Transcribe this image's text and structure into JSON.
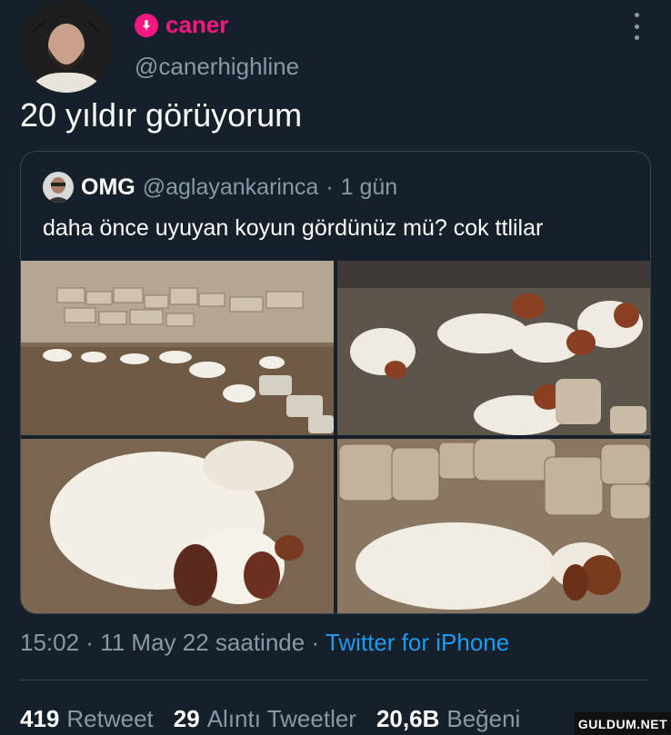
{
  "author": {
    "display_name": "caner",
    "handle": "@canerhighline",
    "badge_icon": "microphone-icon",
    "accent_color": "#f91880"
  },
  "tweet": {
    "text": "20 yıldır görüyorum"
  },
  "quoted": {
    "display_name": "OMG",
    "handle": "@aglayankarinca",
    "separator": "·",
    "age": "1 gün",
    "text": "daha önce uyuyan koyun gördünüz mü? cok ttlilar"
  },
  "meta": {
    "time": "15:02",
    "separator1": "·",
    "date": "11 May 22 saatinde",
    "separator2": "·",
    "source": "Twitter for iPhone"
  },
  "stats": {
    "retweets_count": "419",
    "retweets_label": "Retweet",
    "quotes_count": "29",
    "quotes_label": "Alıntı Tweetler",
    "likes_count": "20,6B",
    "likes_label": "Beğeni"
  },
  "watermark": "GULDUM.NET",
  "colors": {
    "background": "#15202b",
    "muted": "#8899a6",
    "link": "#1d9bf0",
    "border": "#38444d"
  }
}
